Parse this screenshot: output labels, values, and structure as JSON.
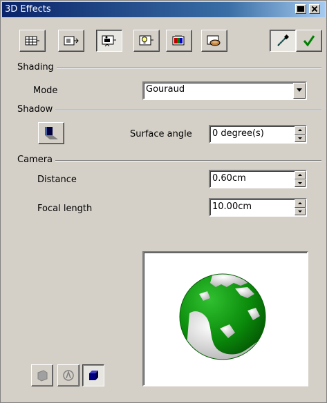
{
  "window": {
    "title": "3D Effects"
  },
  "toolbar": {
    "tools": [
      {
        "icon": "geometry-icon"
      },
      {
        "icon": "shading-icon"
      },
      {
        "icon": "camera-icon",
        "pressed": true
      },
      {
        "icon": "illumination-icon"
      },
      {
        "icon": "textures-icon"
      },
      {
        "icon": "material-icon"
      }
    ],
    "update_icon": "eyedropper-icon",
    "assign_icon": "checkmark-icon"
  },
  "shading": {
    "section": "Shading",
    "mode_label": "Mode",
    "mode_value": "Gouraud"
  },
  "shadow": {
    "section": "Shadow",
    "toggle_icon": "shadow-toggle-icon",
    "surface_angle_label": "Surface angle",
    "surface_angle_value": "0 degree(s)"
  },
  "camera": {
    "section": "Camera",
    "distance_label": "Distance",
    "distance_value": "0.60cm",
    "focal_label": "Focal length",
    "focal_value": "10.00cm"
  },
  "preview": {
    "object": "globe-sphere",
    "colors": {
      "land": "#ffffff",
      "sea": "#0a8a0a"
    }
  },
  "bottom_buttons": [
    {
      "icon": "convert-to-3d-icon"
    },
    {
      "icon": "convert-to-lathe-icon"
    },
    {
      "icon": "perspective-icon",
      "pressed": true
    }
  ]
}
